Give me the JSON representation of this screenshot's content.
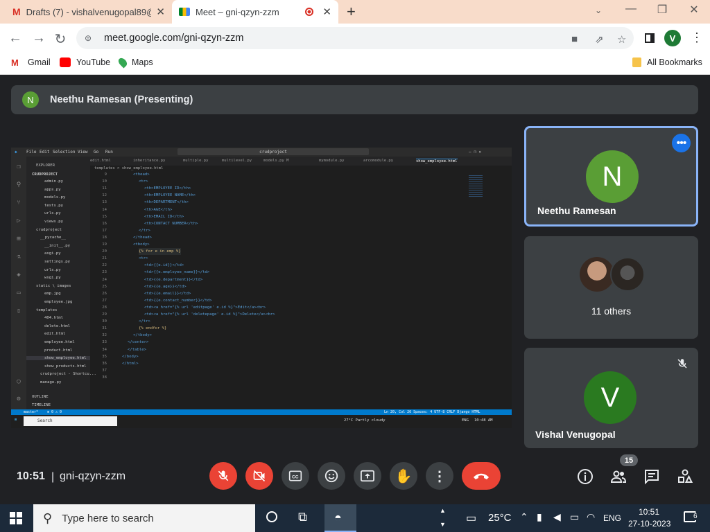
{
  "browser": {
    "tabs": [
      {
        "title": "Drafts (7) - vishalvenugopal89@",
        "icon": "gmail-icon"
      },
      {
        "title": "Meet – gni-qzyn-zzm",
        "icon": "meet-icon"
      }
    ],
    "url": "meet.google.com/gni-qzyn-zzm",
    "profile_initial": "V",
    "bookmarks": [
      {
        "label": "Gmail",
        "icon": "gmail-icon"
      },
      {
        "label": "YouTube",
        "icon": "youtube-icon"
      },
      {
        "label": "Maps",
        "icon": "maps-icon"
      }
    ],
    "all_bookmarks": "All Bookmarks"
  },
  "meet": {
    "presenter": {
      "initial": "N",
      "label": "Neethu Ramesan (Presenting)"
    },
    "tiles": [
      {
        "initial": "N",
        "name": "Neethu Ramesan",
        "color": "#5a9e35"
      },
      {
        "name": "11 others"
      },
      {
        "initial": "V",
        "name": "Vishal Venugopal",
        "color": "#2a7a20"
      }
    ],
    "time": "10:51",
    "separator": "|",
    "meeting_code": "gni-qzyn-zzm",
    "people_count": "15",
    "colors": {
      "bg": "#202124",
      "surface": "#3c4043",
      "danger": "#ea4335",
      "accent": "#8ab4f8"
    }
  },
  "vscode": {
    "menu": [
      "File",
      "Edit",
      "Selection",
      "View",
      "Go",
      "Run"
    ],
    "search": "crudproject",
    "explorer_title": "EXPLORER",
    "project": "CRUDPROJECT",
    "files": [
      "admin.py",
      "apps.py",
      "models.py",
      "tests.py",
      "urls.py",
      "views.py",
      "crudproject",
      "__pycache__",
      "__init__.py",
      "asgi.py",
      "settings.py",
      "urls.py",
      "wsgi.py",
      "static \\ images",
      "emp.jpg",
      "employee.jpg",
      "templates",
      "404.html",
      "delete.html",
      "edit.html",
      "employee.html",
      "product.html",
      "show_employee.html",
      "show_products.html",
      "crudproject - Shortcu...",
      "manage.py"
    ],
    "outline": "OUTLINE",
    "timeline": "TIMELINE",
    "tabs": [
      "edit.html",
      "inheritance.py",
      "multiple.py",
      "multilevel.py",
      "models.py M",
      "mymodule.py",
      "arcomodule.py",
      "show_employee.html"
    ],
    "breadcrumb": "templates > show_employee.html",
    "lines": [
      {
        "n": "9",
        "t": "<thead>",
        "i": 3
      },
      {
        "n": "10",
        "t": "<tr>",
        "i": 4
      },
      {
        "n": "11",
        "t": "<th>EMPLOYEE ID</th>",
        "i": 5
      },
      {
        "n": "12",
        "t": "<th>EMPLOYEE NAME</th>",
        "i": 5
      },
      {
        "n": "13",
        "t": "<th>DEPARTMENT</th>",
        "i": 5
      },
      {
        "n": "14",
        "t": "<th>AGE</th>",
        "i": 5
      },
      {
        "n": "15",
        "t": "<th>EMAIL ID</th>",
        "i": 5
      },
      {
        "n": "16",
        "t": "<th>CONTACT NUMBER</th>",
        "i": 5
      },
      {
        "n": "17",
        "t": "</tr>",
        "i": 4
      },
      {
        "n": "18",
        "t": "</thead>",
        "i": 3
      },
      {
        "n": "19",
        "t": "<tbody>",
        "i": 3
      },
      {
        "n": "20",
        "t": "{% for e in emp %}",
        "i": 4
      },
      {
        "n": "21",
        "t": "<tr>",
        "i": 4
      },
      {
        "n": "22",
        "t": "<td>{{e.id}}</td>",
        "i": 5
      },
      {
        "n": "23",
        "t": "<td>{{e.employee_name}}</td>",
        "i": 5
      },
      {
        "n": "24",
        "t": "<td>{{e.department}}</td>",
        "i": 5
      },
      {
        "n": "25",
        "t": "<td>{{e.age}}</td>",
        "i": 5
      },
      {
        "n": "26",
        "t": "<td>{{e.email}}</td>",
        "i": 5
      },
      {
        "n": "27",
        "t": "<td>{{e.contact_number}}</td>",
        "i": 5
      },
      {
        "n": "28",
        "t": "<td><a href=\"{% url 'editpage' e.id %}\">Edit</a><br>",
        "i": 5
      },
      {
        "n": "29",
        "t": "<td><a href=\"{% url 'deletepage' e.id %}\">Delete</a><br>",
        "i": 5
      },
      {
        "n": "30",
        "t": "</tr>",
        "i": 4
      },
      {
        "n": "31",
        "t": "{% endfor %}",
        "i": 4
      },
      {
        "n": "32",
        "t": "</tbody>",
        "i": 3
      },
      {
        "n": "33",
        "t": "</center>",
        "i": 2
      },
      {
        "n": "34",
        "t": "</table>",
        "i": 2
      },
      {
        "n": "35",
        "t": "</body>",
        "i": 1
      },
      {
        "n": "36",
        "t": "</html>",
        "i": 1
      },
      {
        "n": "37",
        "t": "",
        "i": 0
      },
      {
        "n": "38",
        "t": "",
        "i": 0
      }
    ],
    "status_left": "master*",
    "status_errors": "⊗ 0 ⚠ 0",
    "status_right": "Ln 20, Col 26   Spaces: 4   UTF-8   CRLF   Django HTML",
    "taskbar_search": "Search",
    "weather": "27°C  Partly cloudy",
    "lang": "ENG",
    "clock": "10:48 AM"
  },
  "windows": {
    "search_placeholder": "Type here to search",
    "temperature": "25°C",
    "lang": "ENG",
    "time": "10:51",
    "date": "27-10-2023",
    "notif_count": "6"
  }
}
